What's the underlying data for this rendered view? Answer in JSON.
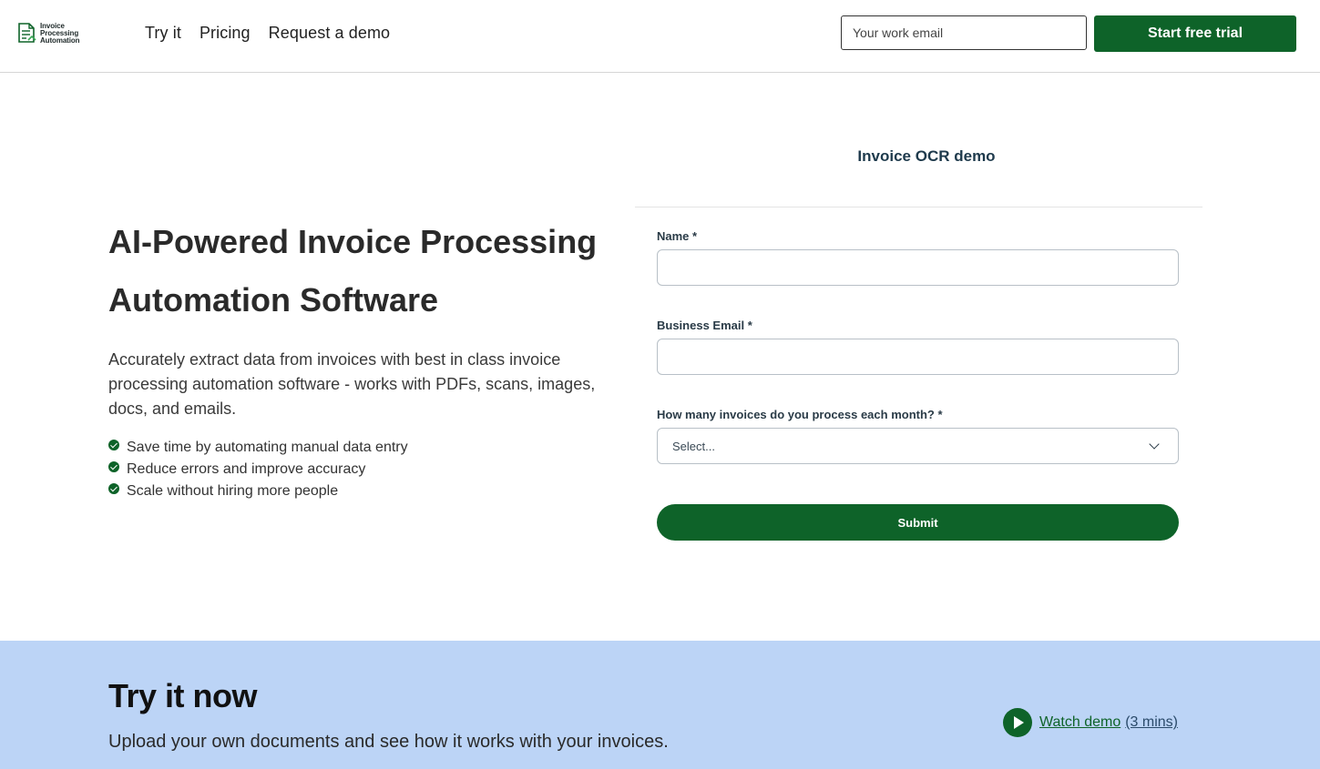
{
  "header": {
    "logo_lines": [
      "Invoice",
      "Processing",
      "Automation"
    ],
    "nav": [
      "Try it",
      "Pricing",
      "Request a demo"
    ],
    "email_placeholder": "Your work email",
    "trial_label": "Start free trial"
  },
  "hero": {
    "title": "AI-Powered Invoice Processing Automation Software",
    "description": "Accurately extract data from invoices with best in class invoice processing automation software - works with PDFs, scans, images, docs, and emails.",
    "benefits": [
      "Save time by automating manual data entry",
      "Reduce errors and improve accuracy",
      "Scale without hiring more people"
    ]
  },
  "form": {
    "title": "Invoice OCR demo",
    "name_label": "Name *",
    "email_label": "Business Email *",
    "volume_label": "How many invoices do you process each month? *",
    "volume_selected": "Select...",
    "submit_label": "Submit"
  },
  "try_section": {
    "title": "Try it now",
    "subtitle": "Upload your own documents and see how it works with your invoices.",
    "watch_label": "Watch demo",
    "watch_duration": "(3 mins)"
  },
  "colors": {
    "brand_green": "#0e6329",
    "section_blue": "#bcd4f6"
  },
  "icons": [
    "logo-document-icon",
    "check-icon",
    "chevron-down-icon",
    "play-icon"
  ]
}
